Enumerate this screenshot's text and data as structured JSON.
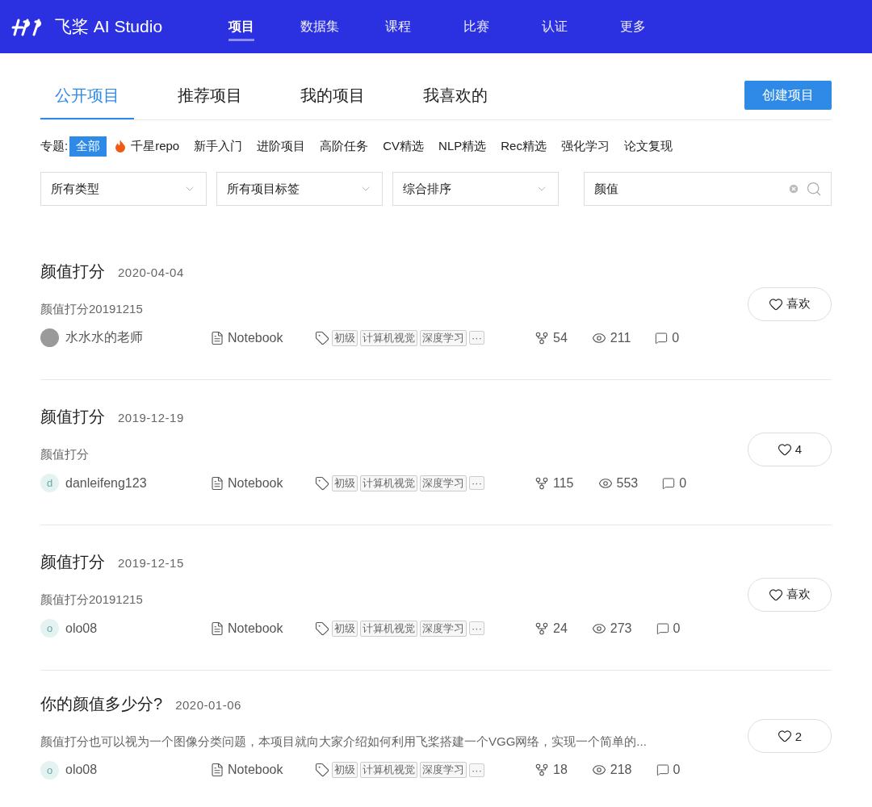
{
  "header": {
    "logo": "飞桨 AI Studio",
    "nav": [
      {
        "label": "项目",
        "selected": true
      },
      {
        "label": "数据集",
        "selected": false
      },
      {
        "label": "课程",
        "selected": false
      },
      {
        "label": "比赛",
        "selected": false
      },
      {
        "label": "认证",
        "selected": false
      },
      {
        "label": "更多",
        "selected": false
      }
    ]
  },
  "tabs": [
    {
      "label": "公开项目",
      "selected": true
    },
    {
      "label": "推荐项目",
      "selected": false
    },
    {
      "label": "我的项目",
      "selected": false
    },
    {
      "label": "我喜欢的",
      "selected": false
    }
  ],
  "create_button": "创建项目",
  "topics": {
    "label": "专题:",
    "items": [
      {
        "label": "全部",
        "selected": true,
        "kind": "plain"
      },
      {
        "label": "千星repo",
        "selected": false,
        "kind": "hot"
      },
      {
        "label": "新手入门",
        "selected": false,
        "kind": "plain"
      },
      {
        "label": "进阶项目",
        "selected": false,
        "kind": "plain"
      },
      {
        "label": "高阶任务",
        "selected": false,
        "kind": "plain"
      },
      {
        "label": "CV精选",
        "selected": false,
        "kind": "plain"
      },
      {
        "label": "NLP精选",
        "selected": false,
        "kind": "plain"
      },
      {
        "label": "Rec精选",
        "selected": false,
        "kind": "plain"
      },
      {
        "label": "强化学习",
        "selected": false,
        "kind": "plain"
      },
      {
        "label": "论文复现",
        "selected": false,
        "kind": "plain"
      }
    ]
  },
  "filters": [
    "所有类型",
    "所有项目标签",
    "综合排序"
  ],
  "search": {
    "value": "颜值"
  },
  "projects": [
    {
      "title": "颜值打分",
      "date": "2020-04-04",
      "description": "颜值打分20191215",
      "author": {
        "name": "水水水的老师",
        "kind": "photo"
      },
      "type": "Notebook",
      "tags": [
        "初级",
        "计算机视觉",
        "深度学习"
      ],
      "more": "···",
      "forks": "54",
      "views": "211",
      "comments": "0",
      "like": "喜欢"
    },
    {
      "title": "颜值打分",
      "date": "2019-12-19",
      "description": "颜值打分",
      "author": {
        "name": "danleifeng123",
        "kind": "letter",
        "letter": "d"
      },
      "type": "Notebook",
      "tags": [
        "初级",
        "计算机视觉",
        "深度学习"
      ],
      "more": "···",
      "forks": "115",
      "views": "553",
      "comments": "0",
      "like": "4"
    },
    {
      "title": "颜值打分",
      "date": "2019-12-15",
      "description": "颜值打分20191215",
      "author": {
        "name": "olo08",
        "kind": "letter",
        "letter": "o"
      },
      "type": "Notebook",
      "tags": [
        "初级",
        "计算机视觉",
        "深度学习"
      ],
      "more": "···",
      "forks": "24",
      "views": "273",
      "comments": "0",
      "like": "喜欢"
    },
    {
      "title": "你的颜值多少分?",
      "date": "2020-01-06",
      "description": "颜值打分也可以视为一个图像分类问题，本项目就向大家介绍如何利用飞桨搭建一个VGG网络，实现一个简单的...",
      "author": {
        "name": "olo08",
        "kind": "letter",
        "letter": "o"
      },
      "type": "Notebook",
      "tags": [
        "初级",
        "计算机视觉",
        "深度学习"
      ],
      "more": "···",
      "forks": "18",
      "views": "218",
      "comments": "0",
      "like": "2"
    }
  ]
}
